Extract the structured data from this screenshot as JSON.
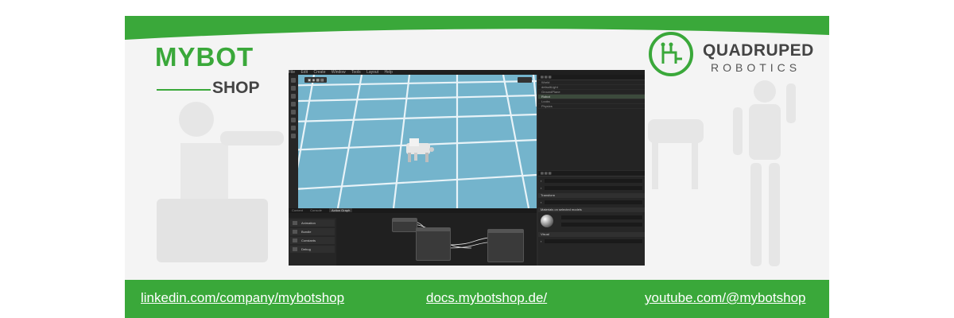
{
  "brand": {
    "left_logo_title": "MYBOT",
    "left_logo_sub": "SHOP",
    "right_logo_title": "QUADRUPED",
    "right_logo_sub": "ROBOTICS",
    "green": "#3aa83a",
    "gray": "#444444"
  },
  "footer": {
    "links": [
      "linkedin.com/company/mybotshop",
      "docs.mybotshop.de/",
      "youtube.com/@mybotshop"
    ]
  },
  "editor": {
    "menu": [
      "File",
      "Edit",
      "Create",
      "Window",
      "Tools",
      "Layout",
      "Help"
    ],
    "stage_rows": [
      "World",
      "defaultLight",
      "GroundPlane",
      "Robot",
      "Looks",
      "Physics"
    ],
    "graph_tabs": [
      "Content",
      "Console",
      "Action Graph"
    ],
    "graph_items": [
      "Animation",
      "Bundle",
      "Constants",
      "Debug"
    ],
    "sections": [
      "Transform",
      "Materials on selected models",
      "Visual"
    ]
  }
}
